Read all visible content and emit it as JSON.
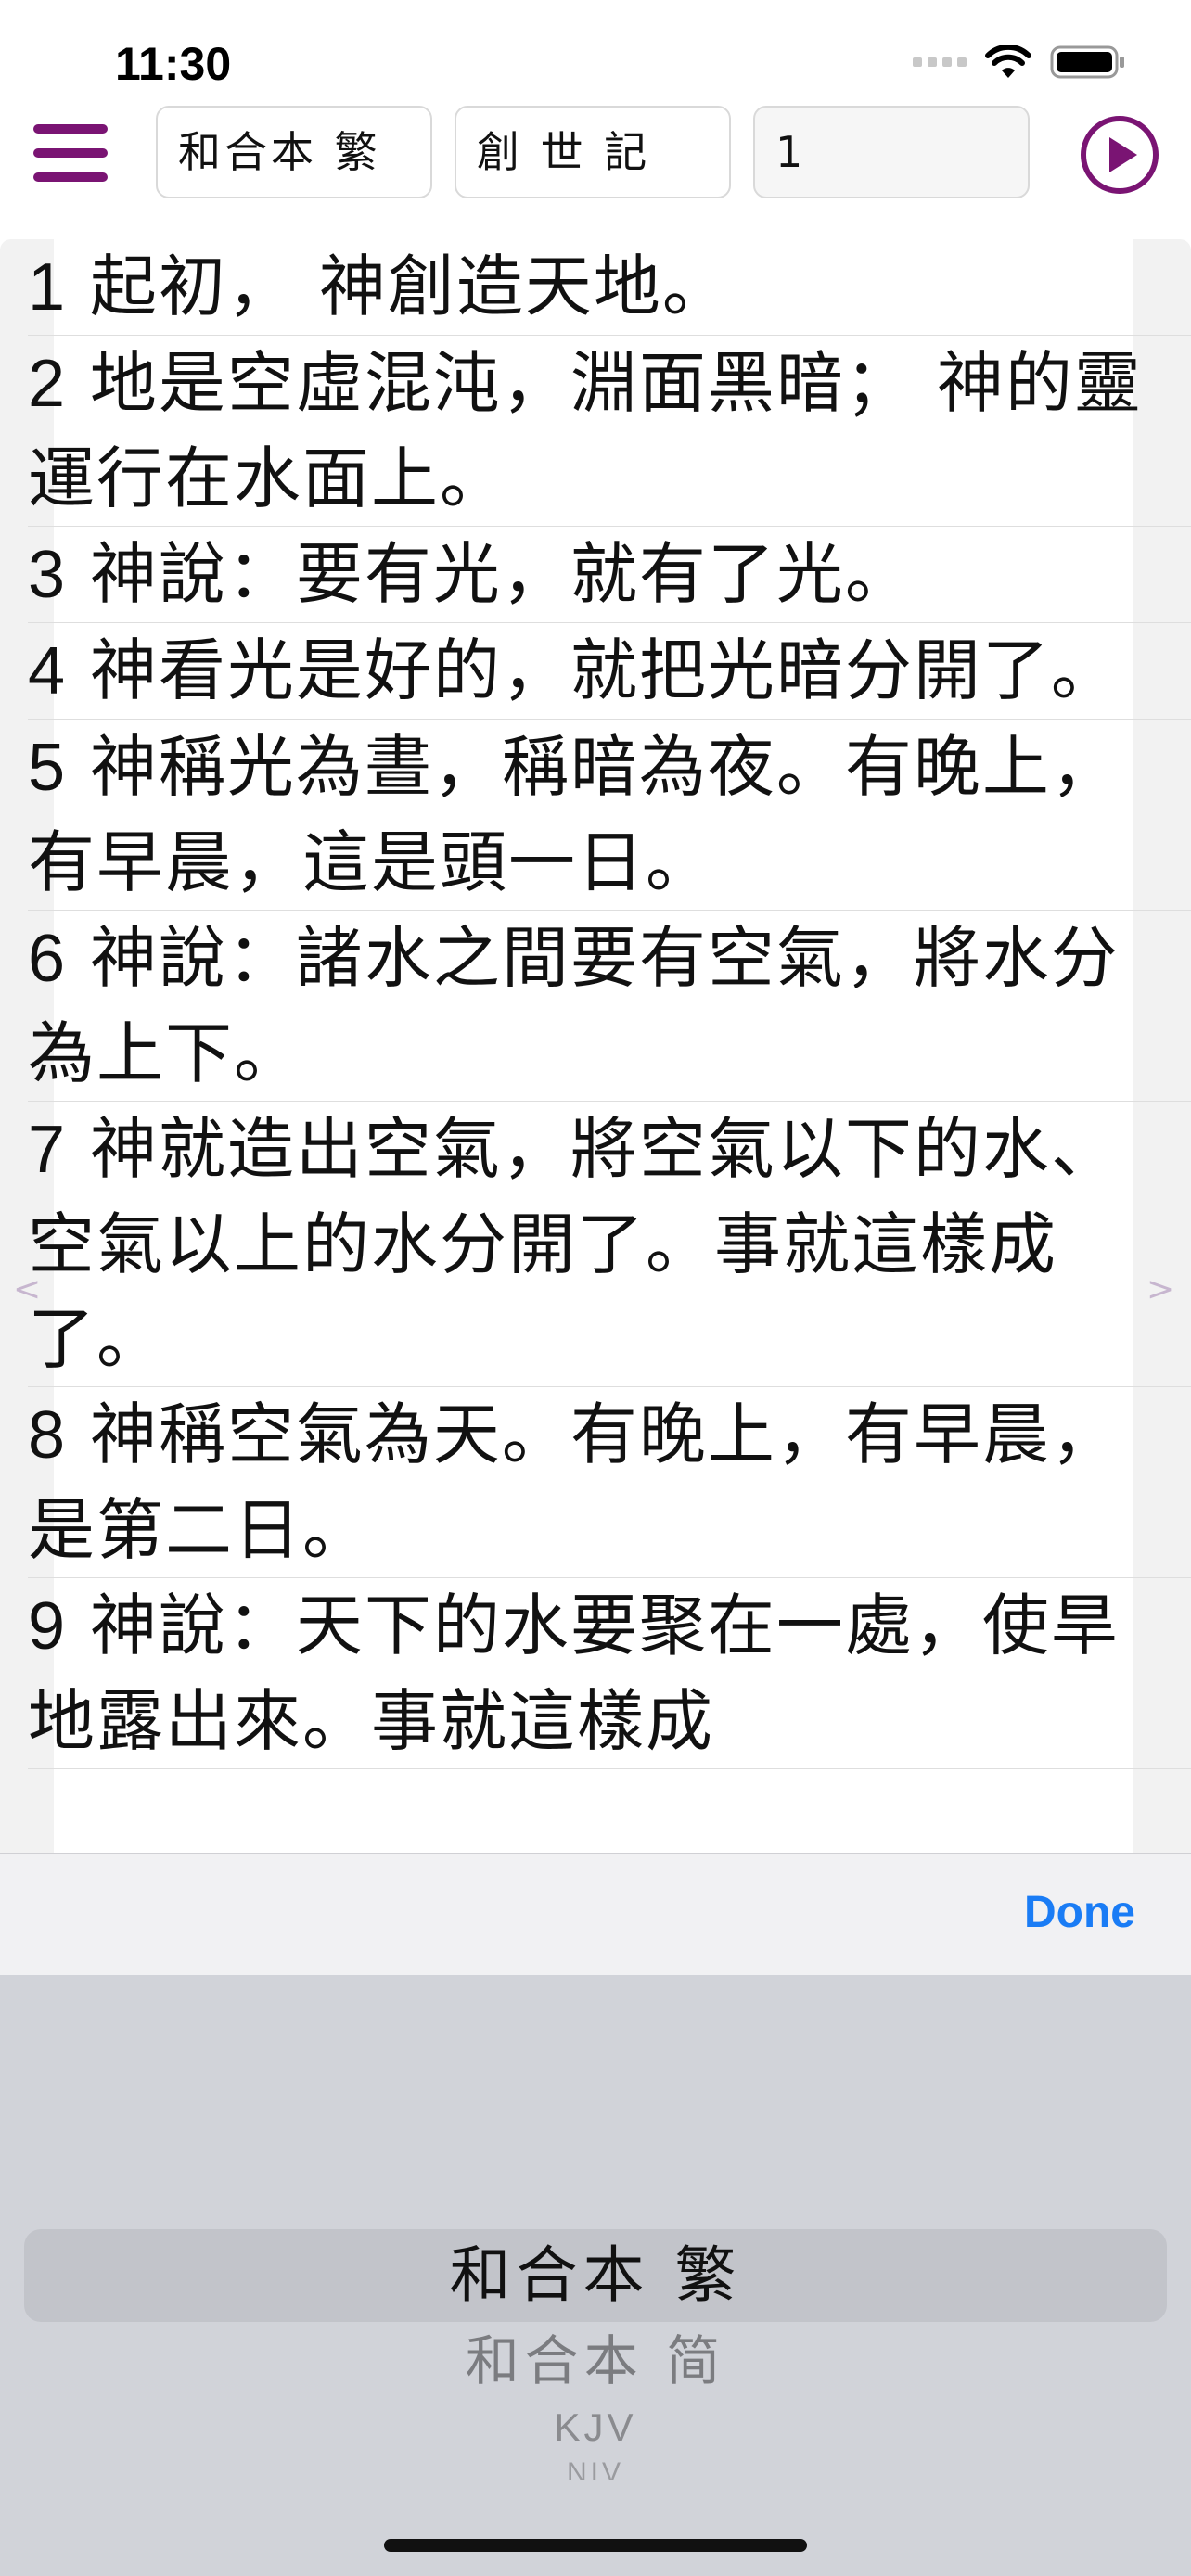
{
  "status": {
    "time": "11:30"
  },
  "toolbar": {
    "version": "和合本 繁",
    "book": "創 世 記",
    "chapter": "1"
  },
  "verses": [
    {
      "num": "1",
      "text": " 起初，    神創造天地。"
    },
    {
      "num": "2",
      "text": " 地是空虛混沌，淵面黑暗； 神的靈運行在水面上。"
    },
    {
      "num": "3",
      "text": "    神說：要有光，就有了光。"
    },
    {
      "num": "4",
      "text": "    神看光是好的，就把光暗分開了。"
    },
    {
      "num": "5",
      "text": "    神稱光為晝，稱暗為夜。有晚上，有早晨，這是頭一日。"
    },
    {
      "num": "6",
      "text": "    神說：諸水之間要有空氣，將水分為上下。"
    },
    {
      "num": "7",
      "text": "    神就造出空氣，將空氣以下的水、空氣以上的水分開了。事就這樣成了。"
    },
    {
      "num": "8",
      "text": "    神稱空氣為天。有晚上，有早晨，是第二日。"
    },
    {
      "num": "9",
      "text": "    神說：天下的水要聚在一處，使旱地露出來。事就這樣成"
    }
  ],
  "nav": {
    "prev": "<",
    "next": ">"
  },
  "picker": {
    "done_label": "Done",
    "options": [
      "和合本 繁",
      "和合本 简",
      "KJV",
      "NIV"
    ],
    "selected": "和合本 繁"
  },
  "colors": {
    "accent": "#7a1473",
    "done": "#1a7cf5"
  }
}
